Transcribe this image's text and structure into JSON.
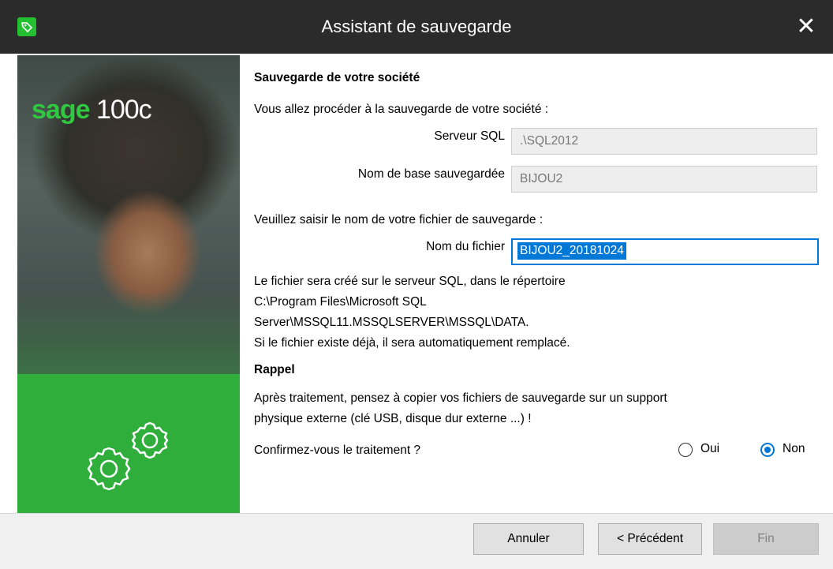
{
  "window": {
    "title": "Assistant de sauvegarde",
    "close_label": "✕"
  },
  "sidebar": {
    "logo_brand": "sage",
    "logo_product": "100c"
  },
  "content": {
    "heading": "Sauvegarde de votre société",
    "intro": "Vous allez procéder à la sauvegarde de votre société :",
    "server_label": "Serveur SQL",
    "server_value": ".\\SQL2012",
    "db_label": "Nom de base sauvegardée",
    "db_value": "BIJOU2",
    "prompt": "Veuillez saisir le nom de votre fichier de sauvegarde :",
    "file_label": "Nom du fichier",
    "file_value": "BIJOU2_20181024",
    "info_line1": "Le fichier sera créé sur le serveur SQL, dans le répertoire",
    "info_line2": "C:\\Program Files\\Microsoft SQL",
    "info_line3": "Server\\MSSQL11.MSSQLSERVER\\MSSQL\\DATA.",
    "info_line4": "Si le fichier existe déjà, il sera automatiquement remplacé.",
    "reminder_title": "Rappel",
    "reminder_line1": "Après traitement, pensez à copier vos fichiers de sauvegarde sur un support",
    "reminder_line2": "physique externe (clé USB, disque dur externe ...) !",
    "confirm_question": "Confirmez-vous le traitement ?",
    "option_yes": "Oui",
    "option_no": "Non",
    "selected_option": "Non"
  },
  "footer": {
    "cancel": "Annuler",
    "previous": "< Précédent",
    "finish": "Fin"
  },
  "colors": {
    "accent": "#0078d7",
    "brand_green": "#2fae3b",
    "titlebar": "#2b2b2b"
  }
}
